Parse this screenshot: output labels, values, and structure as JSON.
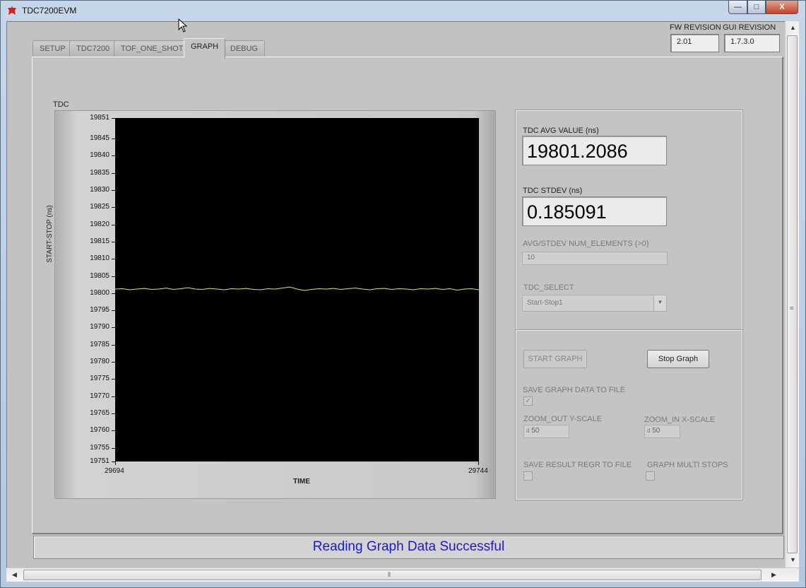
{
  "window": {
    "title": "TDC7200EVM",
    "minimize_glyph": "—",
    "maximize_glyph": "□",
    "close_glyph": "X"
  },
  "tabs": [
    {
      "label": "SETUP",
      "active": false
    },
    {
      "label": "TDC7200",
      "active": false
    },
    {
      "label": "TOF_ONE_SHOT",
      "active": false
    },
    {
      "label": "GRAPH",
      "active": true
    },
    {
      "label": "DEBUG",
      "active": false
    }
  ],
  "revisions": {
    "fw_label": "FW REVISION",
    "fw_value": "2.01",
    "gui_label": "GUI REVISION",
    "gui_value": "1.7.3.0"
  },
  "graph": {
    "label": "TDC"
  },
  "chart_data": {
    "type": "line",
    "title": "TDC",
    "xlabel": "TIME",
    "ylabel": "START-STOP (ns)",
    "xlim": [
      29694,
      29744
    ],
    "ylim": [
      19751,
      19851
    ],
    "y_ticks": [
      "19851",
      "19845",
      "19840",
      "19835",
      "19830",
      "19825",
      "19820",
      "19815",
      "19810",
      "19805",
      "19800",
      "19795",
      "19790",
      "19785",
      "19780",
      "19775",
      "19770",
      "19765",
      "19760",
      "19755",
      "19751"
    ],
    "x_ticks": [
      "29694",
      "29744"
    ],
    "grid": false,
    "background": "#000000",
    "line_color": "#e8e84a",
    "series": [
      {
        "x": [
          29694,
          29695,
          29696,
          29697,
          29698,
          29699,
          29700,
          29701,
          29702,
          29703,
          29704,
          29705,
          29706,
          29707,
          29708,
          29709,
          29710,
          29711,
          29712,
          29713,
          29714,
          29715,
          29716,
          29717,
          29718,
          29719,
          29720,
          29721,
          29722,
          29723,
          29724,
          29725,
          29726,
          29727,
          29728,
          29729,
          29730,
          29731,
          29732,
          29733,
          29734,
          29735,
          29736,
          29737,
          29738,
          29739,
          29740,
          29741,
          29742,
          29743,
          29744
        ],
        "values": [
          19801.2,
          19801.3,
          19801.0,
          19801.2,
          19801.4,
          19801.1,
          19801.2,
          19801.5,
          19801.1,
          19801.3,
          19801.6,
          19801.2,
          19801.1,
          19801.4,
          19801.2,
          19801.0,
          19801.3,
          19801.2,
          19801.4,
          19801.1,
          19801.0,
          19801.3,
          19801.2,
          19801.5,
          19801.8,
          19801.2,
          19800.8,
          19801.1,
          19801.3,
          19801.2,
          19801.4,
          19801.1,
          19801.3,
          19801.5,
          19801.2,
          19801.0,
          19801.3,
          19801.4,
          19801.1,
          19801.3,
          19801.2,
          19801.0,
          19801.3,
          19801.2,
          19801.4,
          19801.1,
          19801.3,
          19800.9,
          19801.2,
          19801.3,
          19801.0
        ]
      }
    ]
  },
  "controls": {
    "avg_label": "TDC AVG VALUE (ns)",
    "avg_value": "19801.2086",
    "stdev_label": "TDC STDEV (ns)",
    "stdev_value": "0.185091",
    "num_elements_label": "AVG/STDEV NUM_ELEMENTS (>0)",
    "num_elements_value": "10",
    "tdc_select_label": "TDC_SELECT",
    "tdc_select_value": "Start-Stop1",
    "start_graph_label": "START GRAPH",
    "stop_graph_label": "Stop Graph",
    "save_graph_label": "SAVE GRAPH DATA TO FILE",
    "save_graph_checked": "✓",
    "zoom_out_label": "ZOOM_OUT Y-SCALE",
    "zoom_out_prefix": "d",
    "zoom_out_value": "50",
    "zoom_in_label": "ZOOM_IN X-SCALE",
    "zoom_in_prefix": "d",
    "zoom_in_value": "50",
    "save_regr_label": "SAVE RESULT REGR TO FILE",
    "multi_stops_label": "GRAPH MULTI STOPS"
  },
  "status": {
    "message": "Reading Graph Data Successful"
  }
}
